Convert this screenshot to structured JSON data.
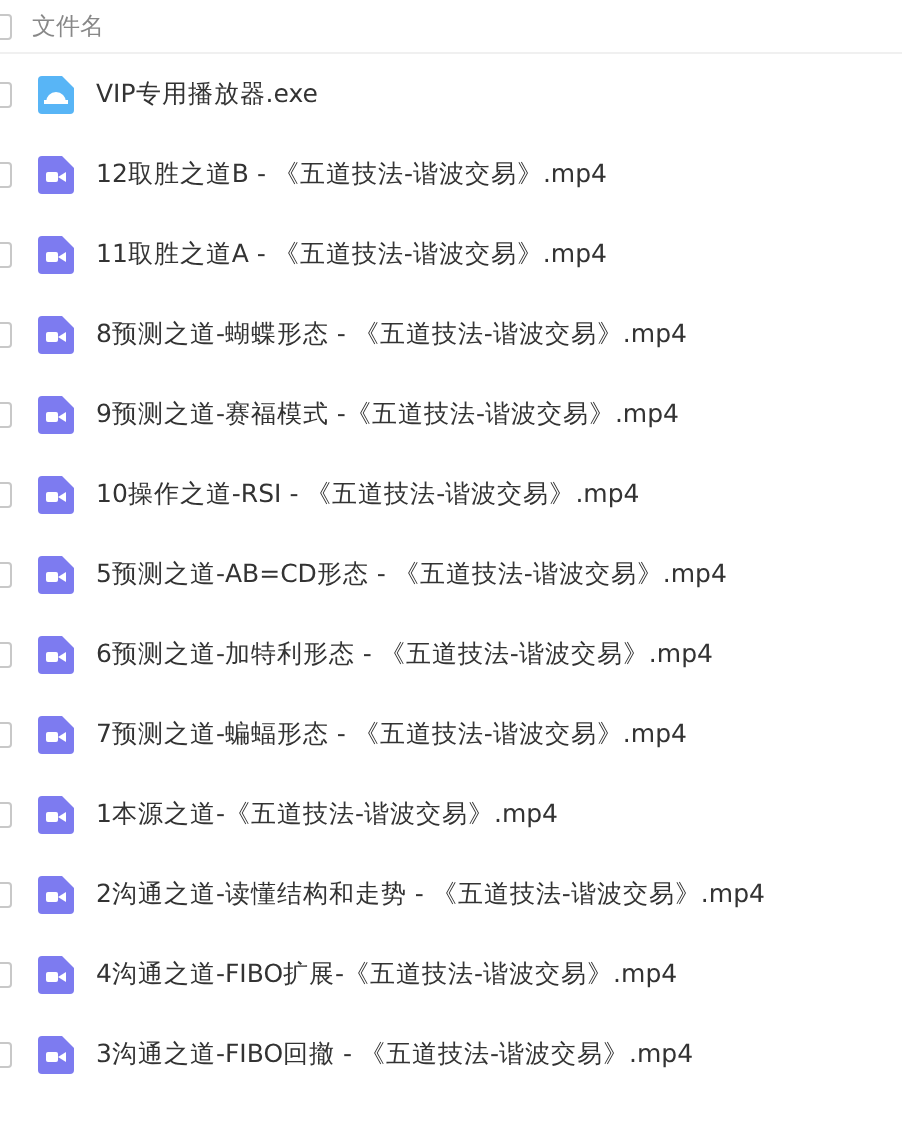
{
  "header": {
    "label": "文件名",
    "checked": false
  },
  "files": [
    {
      "name": "VIP专用播放器.exe",
      "kind": "exe",
      "checked": false
    },
    {
      "name": "12取胜之道B - 《五道技法-谐波交易》.mp4",
      "kind": "video",
      "checked": false
    },
    {
      "name": "11取胜之道A - 《五道技法-谐波交易》.mp4",
      "kind": "video",
      "checked": false
    },
    {
      "name": "8预测之道-蝴蝶形态 -  《五道技法-谐波交易》.mp4",
      "kind": "video",
      "checked": false
    },
    {
      "name": "9预测之道-赛福模式 -《五道技法-谐波交易》.mp4",
      "kind": "video",
      "checked": false
    },
    {
      "name": "10操作之道-RSI - 《五道技法-谐波交易》.mp4",
      "kind": "video",
      "checked": false
    },
    {
      "name": "5预测之道-AB=CD形态 - 《五道技法-谐波交易》.mp4",
      "kind": "video",
      "checked": false
    },
    {
      "name": "6预测之道-加特利形态 - 《五道技法-谐波交易》.mp4",
      "kind": "video",
      "checked": false
    },
    {
      "name": "7预测之道-蝙蝠形态 - 《五道技法-谐波交易》.mp4",
      "kind": "video",
      "checked": false
    },
    {
      "name": "1本源之道-《五道技法-谐波交易》.mp4",
      "kind": "video",
      "checked": false
    },
    {
      "name": "2沟通之道-读懂结构和走势 - 《五道技法-谐波交易》.mp4",
      "kind": "video",
      "checked": false
    },
    {
      "name": "4沟通之道-FIBO扩展-《五道技法-谐波交易》.mp4",
      "kind": "video",
      "checked": false
    },
    {
      "name": "3沟通之道-FIBO回撤 - 《五道技法-谐波交易》.mp4",
      "kind": "video",
      "checked": false
    }
  ]
}
